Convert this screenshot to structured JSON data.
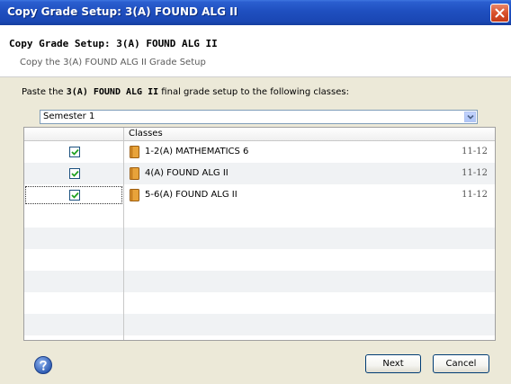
{
  "window": {
    "title": "Copy Grade Setup: 3(A) FOUND ALG II"
  },
  "header": {
    "title": "Copy Grade Setup: 3(A) FOUND ALG II",
    "subtitle": "Copy the 3(A) FOUND ALG II Grade Setup"
  },
  "instruction": {
    "prefix": "Paste the ",
    "bold": "3(A) FOUND ALG II",
    "suffix": " final grade setup to the following classes:"
  },
  "term_select": {
    "value": "Semester 1"
  },
  "grid": {
    "columns": [
      "",
      "Classes"
    ],
    "rows": [
      {
        "checked": true,
        "name": "1-2(A) MATHEMATICS 6",
        "grades": "11-12"
      },
      {
        "checked": true,
        "name": "4(A) FOUND ALG II",
        "grades": "11-12"
      },
      {
        "checked": true,
        "name": "5-6(A) FOUND ALG II",
        "grades": "11-12"
      }
    ]
  },
  "buttons": {
    "next": "Next",
    "cancel": "Cancel"
  },
  "icons": {
    "close": "close-icon",
    "help": "help-icon",
    "class": "book-icon",
    "dropdown": "chevron-down-icon",
    "check": "checkmark-icon"
  },
  "colors": {
    "titlebar": "#1f4fbf",
    "close_button": "#d9512c",
    "book": "#e8a33a",
    "help": "#3f6fc6"
  }
}
